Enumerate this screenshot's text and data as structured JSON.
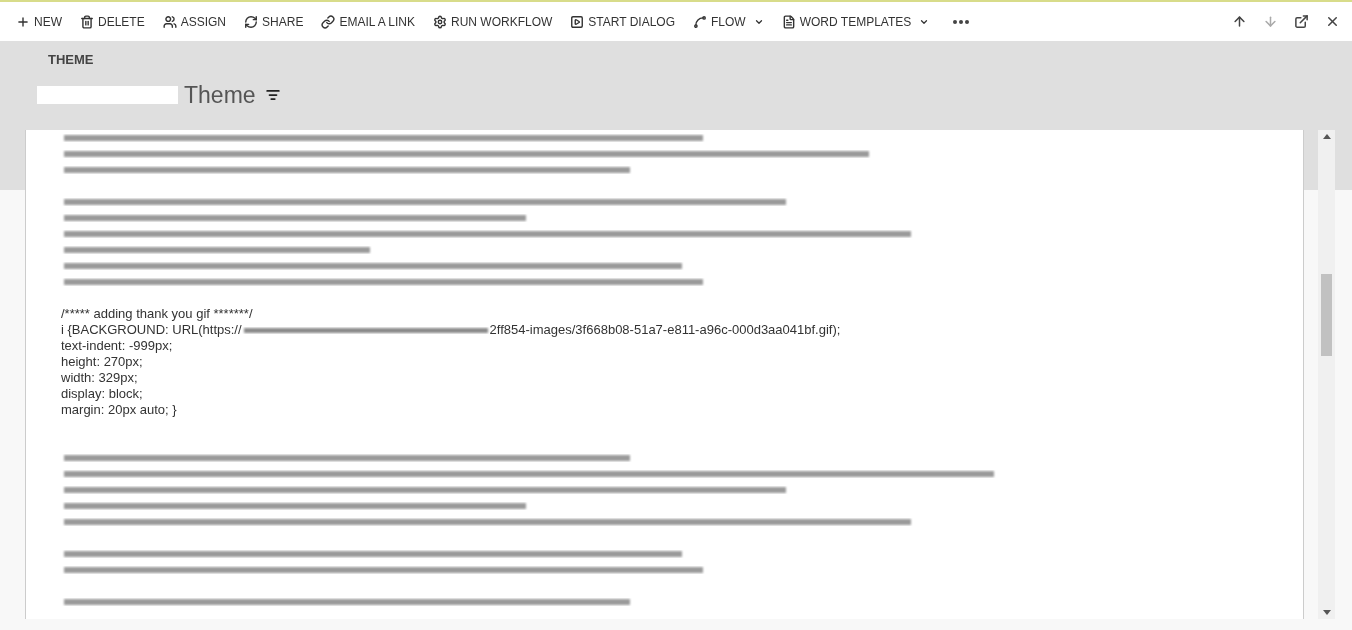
{
  "toolbar": {
    "items": [
      {
        "kind": "new",
        "label": "NEW",
        "dropdown": false
      },
      {
        "kind": "delete",
        "label": "DELETE",
        "dropdown": false
      },
      {
        "kind": "assign",
        "label": "ASSIGN",
        "dropdown": false
      },
      {
        "kind": "share",
        "label": "SHARE",
        "dropdown": false
      },
      {
        "kind": "link",
        "label": "EMAIL A LINK",
        "dropdown": false
      },
      {
        "kind": "workflow",
        "label": "RUN WORKFLOW",
        "dropdown": false
      },
      {
        "kind": "dialog",
        "label": "START DIALOG",
        "dropdown": false
      },
      {
        "kind": "flow",
        "label": "FLOW",
        "dropdown": true
      },
      {
        "kind": "word",
        "label": "WORD TEMPLATES",
        "dropdown": true
      }
    ],
    "nav": [
      {
        "kind": "up",
        "disabled": false
      },
      {
        "kind": "down",
        "disabled": true
      },
      {
        "kind": "popout",
        "disabled": false
      },
      {
        "kind": "close",
        "disabled": false
      }
    ]
  },
  "header": {
    "entity": "THEME",
    "title": "Theme"
  },
  "editor": {
    "lines": [
      {
        "kind": "blurred"
      },
      {
        "kind": "blurred"
      },
      {
        "kind": "blurred"
      },
      {
        "kind": "gap"
      },
      {
        "kind": "blurred"
      },
      {
        "kind": "blurred"
      },
      {
        "kind": "blurred"
      },
      {
        "kind": "blurred"
      },
      {
        "kind": "blurred"
      },
      {
        "kind": "blurred"
      },
      {
        "kind": "gap"
      },
      {
        "kind": "text",
        "text": "/***** adding thank you gif *******/"
      },
      {
        "kind": "redacted",
        "before": "i {BACKGROUND: URL(https://",
        "after": "2ff854-images/3f668b08-51a7-e811-a96c-000d3aa041bf.gif);"
      },
      {
        "kind": "text",
        "text": "text-indent: -999px;"
      },
      {
        "kind": "text",
        "text": "height: 270px;"
      },
      {
        "kind": "text",
        "text": "width: 329px;"
      },
      {
        "kind": "text",
        "text": "display: block;"
      },
      {
        "kind": "text",
        "text": "margin: 20px auto; }"
      },
      {
        "kind": "gap"
      },
      {
        "kind": "gap"
      },
      {
        "kind": "blurred"
      },
      {
        "kind": "blurred"
      },
      {
        "kind": "blurred"
      },
      {
        "kind": "blurred"
      },
      {
        "kind": "blurred"
      },
      {
        "kind": "gap"
      },
      {
        "kind": "blurred"
      },
      {
        "kind": "blurred"
      },
      {
        "kind": "gap"
      },
      {
        "kind": "blurred"
      }
    ]
  }
}
